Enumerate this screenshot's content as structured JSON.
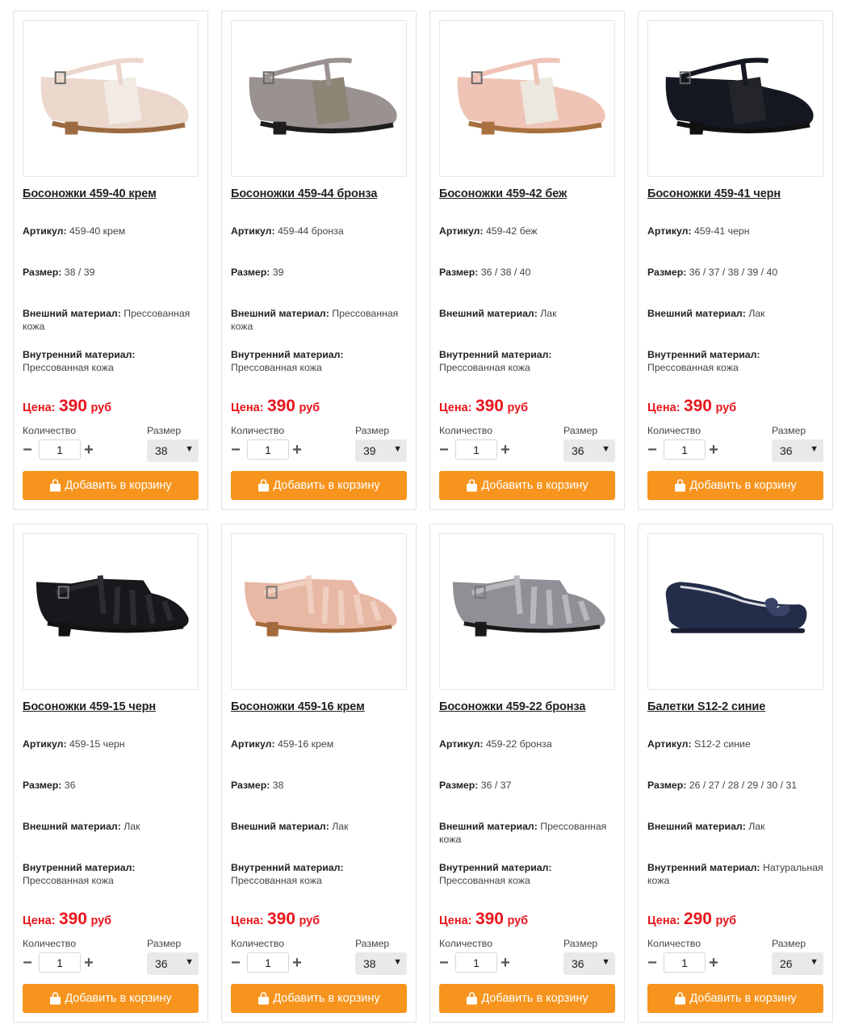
{
  "labels": {
    "article": "Артикул:",
    "size": "Размер:",
    "outer": "Внешний материал:",
    "inner": "Внутренний материал:",
    "price": "Цена:",
    "currency": "руб",
    "quantity": "Количество",
    "size_select": "Размер",
    "add_to_cart": "Добавить в корзину"
  },
  "colors": {
    "accent": "#f7941d",
    "price": "#e8161c"
  },
  "products": [
    {
      "title": "Босоножки 459-40 крем",
      "article": "459-40 крем",
      "sizes": "38 / 39",
      "outer": "Прессованная кожа",
      "inner": "Прессованная кожа",
      "price": "390",
      "qty": "1",
      "selected_size": "38",
      "image": {
        "icon": "sandal-tstrap-icon",
        "body": "#ecd7cd",
        "panel": "#f1ebe4",
        "sole": "#9c6a41"
      }
    },
    {
      "title": "Босоножки 459-44 бронза",
      "article": "459-44 бронза",
      "sizes": "39",
      "outer": "Прессованная кожа",
      "inner": "Прессованная кожа",
      "price": "390",
      "qty": "1",
      "selected_size": "39",
      "image": {
        "icon": "sandal-tstrap-icon",
        "body": "#9a9290",
        "panel": "#8c8576",
        "sole": "#1d1d1d"
      }
    },
    {
      "title": "Босоножки 459-42 беж",
      "article": "459-42 беж",
      "sizes": "36 / 38 / 40",
      "outer": "Лак",
      "inner": "Прессованная кожа",
      "price": "390",
      "qty": "1",
      "selected_size": "36",
      "image": {
        "icon": "sandal-tstrap-icon",
        "body": "#efc4b6",
        "panel": "#ece8df",
        "sole": "#a8703e"
      }
    },
    {
      "title": "Босоножки 459-41 черн",
      "article": "459-41 черн",
      "sizes": "36 / 37 / 38 / 39 / 40",
      "outer": "Лак",
      "inner": "Прессованная кожа",
      "price": "390",
      "qty": "1",
      "selected_size": "36",
      "image": {
        "icon": "sandal-tstrap-icon",
        "body": "#151820",
        "panel": "#23252a",
        "sole": "#111111"
      }
    },
    {
      "title": "Босоножки 459-15 черн",
      "article": "459-15 черн",
      "sizes": "36",
      "outer": "Лак",
      "inner": "Прессованная кожа",
      "price": "390",
      "qty": "1",
      "selected_size": "36",
      "image": {
        "icon": "sandal-cage-icon",
        "body": "#16181c",
        "panel": "#2a2c30",
        "sole": "#121212"
      }
    },
    {
      "title": "Босоножки 459-16 крем",
      "article": "459-16 крем",
      "sizes": "38",
      "outer": "Лак",
      "inner": "Прессованная кожа",
      "price": "390",
      "qty": "1",
      "selected_size": "38",
      "image": {
        "icon": "sandal-cage-icon",
        "body": "#e8b8a5",
        "panel": "#f0cfc0",
        "sole": "#a46a3c"
      }
    },
    {
      "title": "Босоножки 459-22 бронза",
      "article": "459-22 бронза",
      "sizes": "36 / 37",
      "outer": "Прессованная кожа",
      "inner": "Прессованная кожа",
      "price": "390",
      "qty": "1",
      "selected_size": "36",
      "image": {
        "icon": "sandal-cage-icon",
        "body": "#8f9095",
        "panel": "#b7b7bc",
        "sole": "#1a1a1a"
      }
    },
    {
      "title": "Балетки S12-2 синие",
      "article": "S12-2 синие",
      "sizes": "26 / 27 / 28 / 29 / 30 / 31",
      "outer": "Лак",
      "inner": "Натуральная кожа",
      "price": "290",
      "qty": "1",
      "selected_size": "26",
      "image": {
        "icon": "ballet-flat-icon",
        "body": "#232c48",
        "panel": "#39436a",
        "sole": "#1a1f33"
      }
    }
  ]
}
